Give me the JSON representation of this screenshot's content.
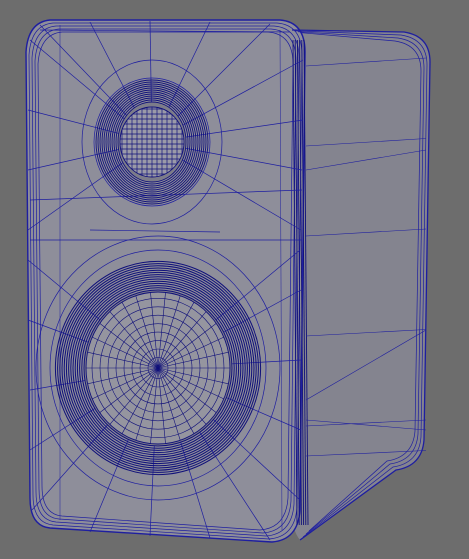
{
  "viewport": {
    "background": "#6d6d6d",
    "subject": "speaker-cabinet-wireframe",
    "display_mode": "wireframe-on-shaded"
  },
  "colors": {
    "wire": "#1e1ea0",
    "wire_dense": "#10107a",
    "front_face": "#8e8e9a",
    "side_face": "#84848f",
    "driver_shadow": "#7c7c8a"
  },
  "speaker": {
    "parts": [
      "cabinet-front",
      "cabinet-side",
      "tweeter",
      "woofer"
    ]
  }
}
